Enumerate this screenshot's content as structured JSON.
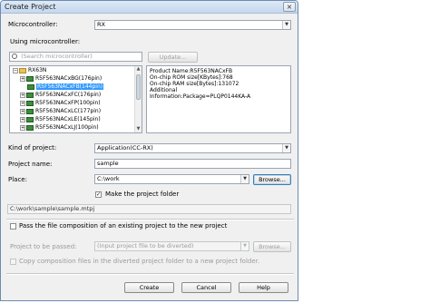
{
  "window": {
    "title": "Create Project",
    "close_glyph": "×"
  },
  "microcontroller": {
    "label": "Microcontroller:",
    "value": "RX",
    "arrow": "▼"
  },
  "using": {
    "label": "Using microcontroller:",
    "search_placeholder": "(Search microcontroller)",
    "update_label": "Update..."
  },
  "tree": {
    "root": "RX63N",
    "root_expander": "−",
    "items": [
      {
        "label": "R5F563NACxBG(176pin)",
        "expander": "+",
        "selected": false
      },
      {
        "label": "R5F563NACxFB(144pin)",
        "expander": "",
        "selected": true
      },
      {
        "label": "R5F563NACxFC(176pin)",
        "expander": "+",
        "selected": false
      },
      {
        "label": "R5F563NACxFP(100pin)",
        "expander": "+",
        "selected": false
      },
      {
        "label": "R5F563NACxLC(177pin)",
        "expander": "+",
        "selected": false
      },
      {
        "label": "R5F563NACxLE(145pin)",
        "expander": "+",
        "selected": false
      },
      {
        "label": "R5F563NACxLJ(100pin)",
        "expander": "+",
        "selected": false
      }
    ]
  },
  "info": {
    "lines": [
      "Product Name:R5F563NACxFB",
      "On-chip ROM size[KBytes]:768",
      "On-chip RAM size[Bytes]:131072",
      "Additional",
      "Information:Package=PLQP0144KA-A"
    ]
  },
  "kind": {
    "label": "Kind of project:",
    "value": "Application(CC-RX)",
    "arrow": "▼"
  },
  "project_name": {
    "label": "Project name:",
    "value": "sample"
  },
  "place": {
    "label": "Place:",
    "value": "C:\\work",
    "arrow": "▼",
    "browse_label": "Browse..."
  },
  "make_folder": {
    "label": "Make the project folder",
    "checked": "✓"
  },
  "path_display": "C:\\work\\sample\\sample.mtpj",
  "pass_composition": {
    "label": "Pass the file composition of an existing project to the new project"
  },
  "passed": {
    "label": "Project to be passed:",
    "placeholder": "(Input project file to be diverted)",
    "arrow": "▼",
    "browse_label": "Browse..."
  },
  "copy_files": {
    "label": "Copy composition files in the diverted project folder to a new project folder."
  },
  "footer": {
    "create_label": "Create",
    "cancel_label": "Cancel",
    "help_label": "Help"
  }
}
